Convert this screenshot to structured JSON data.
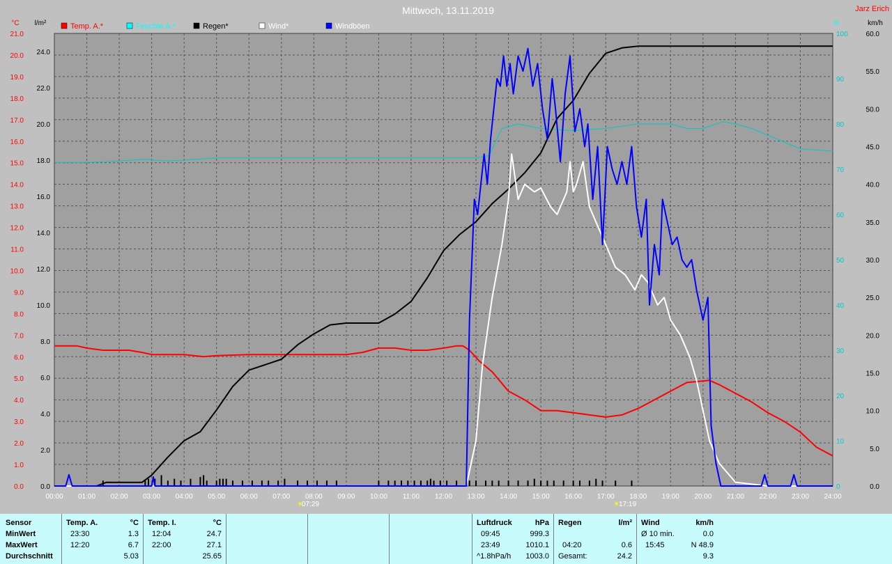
{
  "header": {
    "title": "Mittwoch, 13.11.2019",
    "author": "Jarz Erich"
  },
  "colors": {
    "temp": "#ff0000",
    "humidity": "#00c8c8",
    "rain": "#000000",
    "wind": "#ffffff",
    "gust": "#0000ff",
    "bg": "#c0c0c0",
    "plot": "#a0a0a0",
    "grid": "#606060",
    "stats_bg": "#c8fcfc"
  },
  "axes": {
    "left_temp_unit": "°C",
    "left_rain_unit": "l/m²",
    "right_hum_unit": "%",
    "right_wind_unit": "km/h",
    "sunrise": "07:29",
    "sunset": "17:19"
  },
  "chart_data": {
    "type": "line",
    "x_unit": "hours",
    "x_ticks": [
      "00:00",
      "01:00",
      "02:00",
      "03:00",
      "04:00",
      "05:00",
      "06:00",
      "07:00",
      "08:00",
      "09:00",
      "10:00",
      "11:00",
      "12:00",
      "13:00",
      "14:00",
      "15:00",
      "16:00",
      "17:00",
      "18:00",
      "19:00",
      "20:00",
      "21:00",
      "22:00",
      "23:00",
      "24:00"
    ],
    "xlim": [
      0,
      24
    ],
    "temp_ticks": [
      "0.0",
      "1.0",
      "2.0",
      "3.0",
      "4.0",
      "5.0",
      "6.0",
      "7.0",
      "8.0",
      "9.0",
      "10.0",
      "11.0",
      "12.0",
      "13.0",
      "14.0",
      "15.0",
      "16.0",
      "17.0",
      "18.0",
      "19.0",
      "20.0",
      "21.0"
    ],
    "temp_lim": [
      0,
      21
    ],
    "rain_ticks": [
      "0.0",
      "2.0",
      "4.0",
      "6.0",
      "8.0",
      "10.0",
      "12.0",
      "14.0",
      "16.0",
      "18.0",
      "20.0",
      "22.0",
      "24.0"
    ],
    "rain_lim": [
      0,
      25
    ],
    "hum_ticks": [
      "0",
      "10",
      "20",
      "30",
      "40",
      "50",
      "60",
      "70",
      "80",
      "90",
      "100"
    ],
    "hum_lim": [
      0,
      100
    ],
    "wind_ticks": [
      "0.0",
      "5.0",
      "10.0",
      "15.0",
      "20.0",
      "25.0",
      "30.0",
      "35.0",
      "40.0",
      "45.0",
      "50.0",
      "55.0",
      "60.0"
    ],
    "wind_lim": [
      0,
      60
    ],
    "series": [
      {
        "name": "Temp. A.*",
        "axis": "temp",
        "color": "#ff0000",
        "points": [
          [
            0,
            6.5
          ],
          [
            0.7,
            6.5
          ],
          [
            1,
            6.4
          ],
          [
            1.5,
            6.3
          ],
          [
            2,
            6.3
          ],
          [
            2.3,
            6.3
          ],
          [
            2.7,
            6.2
          ],
          [
            3,
            6.1
          ],
          [
            4,
            6.1
          ],
          [
            4.6,
            6.0
          ],
          [
            5,
            6.05
          ],
          [
            6,
            6.1
          ],
          [
            7,
            6.1
          ],
          [
            8,
            6.1
          ],
          [
            9,
            6.1
          ],
          [
            9.5,
            6.2
          ],
          [
            10,
            6.4
          ],
          [
            10.5,
            6.4
          ],
          [
            11,
            6.3
          ],
          [
            11.5,
            6.3
          ],
          [
            12,
            6.4
          ],
          [
            12.4,
            6.5
          ],
          [
            12.6,
            6.5
          ],
          [
            12.8,
            6.3
          ],
          [
            13.1,
            5.8
          ],
          [
            13.5,
            5.3
          ],
          [
            14,
            4.4
          ],
          [
            14.5,
            4.0
          ],
          [
            15,
            3.5
          ],
          [
            15.5,
            3.5
          ],
          [
            16,
            3.4
          ],
          [
            16.5,
            3.3
          ],
          [
            17,
            3.2
          ],
          [
            17.5,
            3.3
          ],
          [
            18,
            3.6
          ],
          [
            18.5,
            4.0
          ],
          [
            19,
            4.4
          ],
          [
            19.5,
            4.8
          ],
          [
            20.2,
            4.9
          ],
          [
            20.5,
            4.7
          ],
          [
            21,
            4.3
          ],
          [
            21.5,
            3.9
          ],
          [
            22,
            3.4
          ],
          [
            22.5,
            3.0
          ],
          [
            23,
            2.5
          ],
          [
            23.5,
            1.8
          ],
          [
            24,
            1.4
          ]
        ]
      },
      {
        "name": "Feuchte A.*",
        "axis": "hum",
        "color": "#00c8c8",
        "points": [
          [
            0,
            71.5
          ],
          [
            1,
            71.5
          ],
          [
            2,
            71.8
          ],
          [
            2.8,
            72.2
          ],
          [
            3.5,
            71.8
          ],
          [
            4,
            72
          ],
          [
            5,
            72.5
          ],
          [
            6,
            72.5
          ],
          [
            8,
            72.5
          ],
          [
            10,
            72.5
          ],
          [
            12,
            72.5
          ],
          [
            13,
            72.5
          ],
          [
            13.4,
            73
          ],
          [
            13.8,
            79
          ],
          [
            14.3,
            80
          ],
          [
            15,
            79
          ],
          [
            16,
            78.5
          ],
          [
            17,
            79
          ],
          [
            18,
            80
          ],
          [
            19,
            80
          ],
          [
            19.5,
            79
          ],
          [
            20,
            79
          ],
          [
            20.6,
            80.5
          ],
          [
            21,
            80
          ],
          [
            21.5,
            79
          ],
          [
            22,
            77.5
          ],
          [
            22.5,
            76
          ],
          [
            23,
            74.5
          ],
          [
            24,
            74
          ]
        ]
      },
      {
        "name": "Regen*",
        "axis": "rain",
        "color": "#000000",
        "points": [
          [
            0,
            0
          ],
          [
            1.3,
            0
          ],
          [
            1.6,
            0.2
          ],
          [
            2,
            0.2
          ],
          [
            2.7,
            0.2
          ],
          [
            3,
            0.6
          ],
          [
            3.5,
            1.6
          ],
          [
            4,
            2.5
          ],
          [
            4.5,
            3.0
          ],
          [
            5,
            4.2
          ],
          [
            5.5,
            5.5
          ],
          [
            6,
            6.4
          ],
          [
            6.5,
            6.7
          ],
          [
            7,
            7.0
          ],
          [
            7.5,
            7.8
          ],
          [
            8,
            8.4
          ],
          [
            8.5,
            8.9
          ],
          [
            9,
            9.0
          ],
          [
            10,
            9.0
          ],
          [
            10.5,
            9.5
          ],
          [
            11,
            10.2
          ],
          [
            11.5,
            11.5
          ],
          [
            12,
            13.0
          ],
          [
            12.5,
            13.9
          ],
          [
            13,
            14.6
          ],
          [
            13.5,
            15.6
          ],
          [
            14,
            16.4
          ],
          [
            14.5,
            17.3
          ],
          [
            15,
            18.4
          ],
          [
            15.5,
            20.3
          ],
          [
            16,
            21.3
          ],
          [
            16.5,
            22.8
          ],
          [
            17,
            23.9
          ],
          [
            17.5,
            24.2
          ],
          [
            18,
            24.3
          ],
          [
            20,
            24.3
          ],
          [
            22,
            24.3
          ],
          [
            24,
            24.3
          ]
        ]
      },
      {
        "name": "Wind*",
        "axis": "wind",
        "color": "#ffffff",
        "points": [
          [
            0,
            0
          ],
          [
            12.7,
            0
          ],
          [
            13,
            6
          ],
          [
            13.2,
            16
          ],
          [
            13.5,
            25
          ],
          [
            13.8,
            32
          ],
          [
            14,
            38
          ],
          [
            14.1,
            44
          ],
          [
            14.3,
            38
          ],
          [
            14.5,
            40
          ],
          [
            14.8,
            39
          ],
          [
            15,
            39.5
          ],
          [
            15.3,
            37
          ],
          [
            15.5,
            36
          ],
          [
            15.8,
            39
          ],
          [
            15.9,
            43
          ],
          [
            16,
            39
          ],
          [
            16.1,
            40
          ],
          [
            16.3,
            43
          ],
          [
            16.5,
            37
          ],
          [
            16.8,
            34
          ],
          [
            17,
            32
          ],
          [
            17.3,
            29
          ],
          [
            17.6,
            28
          ],
          [
            17.9,
            26
          ],
          [
            18.1,
            28
          ],
          [
            18.3,
            27
          ],
          [
            18.6,
            24
          ],
          [
            18.8,
            25
          ],
          [
            19,
            22
          ],
          [
            19.3,
            20
          ],
          [
            19.6,
            17
          ],
          [
            19.8,
            14
          ],
          [
            20,
            10
          ],
          [
            20.2,
            6
          ],
          [
            20.5,
            3
          ],
          [
            21,
            0.5
          ],
          [
            22,
            0
          ],
          [
            24,
            0
          ]
        ]
      },
      {
        "name": "Windböen",
        "axis": "wind",
        "color": "#0000ff",
        "points": [
          [
            0,
            0
          ],
          [
            0.35,
            0
          ],
          [
            0.45,
            1.5
          ],
          [
            0.55,
            0
          ],
          [
            3.0,
            0
          ],
          [
            3.05,
            1.2
          ],
          [
            3.1,
            0
          ],
          [
            12.7,
            0
          ],
          [
            12.8,
            22
          ],
          [
            12.95,
            38
          ],
          [
            13.05,
            36
          ],
          [
            13.15,
            40
          ],
          [
            13.25,
            44
          ],
          [
            13.35,
            40
          ],
          [
            13.45,
            46
          ],
          [
            13.55,
            50
          ],
          [
            13.65,
            54
          ],
          [
            13.75,
            53
          ],
          [
            13.85,
            57
          ],
          [
            13.95,
            53
          ],
          [
            14.05,
            56
          ],
          [
            14.15,
            52
          ],
          [
            14.3,
            57
          ],
          [
            14.45,
            55
          ],
          [
            14.6,
            58
          ],
          [
            14.75,
            53
          ],
          [
            14.9,
            56
          ],
          [
            15.05,
            50
          ],
          [
            15.2,
            46
          ],
          [
            15.35,
            54
          ],
          [
            15.45,
            50
          ],
          [
            15.6,
            43
          ],
          [
            15.75,
            52
          ],
          [
            15.9,
            57
          ],
          [
            16.05,
            47
          ],
          [
            16.2,
            50
          ],
          [
            16.35,
            45
          ],
          [
            16.45,
            48
          ],
          [
            16.6,
            38
          ],
          [
            16.75,
            45
          ],
          [
            16.9,
            32
          ],
          [
            17.05,
            45
          ],
          [
            17.2,
            42
          ],
          [
            17.35,
            40
          ],
          [
            17.5,
            43
          ],
          [
            17.65,
            40
          ],
          [
            17.8,
            45
          ],
          [
            17.95,
            37
          ],
          [
            18.1,
            33
          ],
          [
            18.25,
            38
          ],
          [
            18.35,
            24
          ],
          [
            18.5,
            32
          ],
          [
            18.65,
            28
          ],
          [
            18.75,
            38
          ],
          [
            18.9,
            35
          ],
          [
            19.05,
            32
          ],
          [
            19.2,
            33
          ],
          [
            19.35,
            30
          ],
          [
            19.5,
            29
          ],
          [
            19.65,
            30
          ],
          [
            19.8,
            26
          ],
          [
            20.0,
            22
          ],
          [
            20.15,
            25
          ],
          [
            20.25,
            8
          ],
          [
            20.4,
            3
          ],
          [
            20.55,
            0
          ],
          [
            21.8,
            0
          ],
          [
            21.9,
            1.5
          ],
          [
            22.0,
            0
          ],
          [
            22.7,
            0
          ],
          [
            22.8,
            1.5
          ],
          [
            22.9,
            0
          ],
          [
            24,
            0
          ]
        ]
      }
    ],
    "rain_bars": [
      [
        1.5,
        0.3
      ],
      [
        2.8,
        0.3
      ],
      [
        2.9,
        0.4
      ],
      [
        3.1,
        0.4
      ],
      [
        3.3,
        0.6
      ],
      [
        3.5,
        0.3
      ],
      [
        3.7,
        0.4
      ],
      [
        3.9,
        0.3
      ],
      [
        4.2,
        0.4
      ],
      [
        4.5,
        0.5
      ],
      [
        4.6,
        0.6
      ],
      [
        4.7,
        0.3
      ],
      [
        5.0,
        0.3
      ],
      [
        5.1,
        0.4
      ],
      [
        5.2,
        0.4
      ],
      [
        5.3,
        0.4
      ],
      [
        5.5,
        0.3
      ],
      [
        5.8,
        0.3
      ],
      [
        6.1,
        0.3
      ],
      [
        6.4,
        0.3
      ],
      [
        6.6,
        0.3
      ],
      [
        6.9,
        0.3
      ],
      [
        7.1,
        0.4
      ],
      [
        7.5,
        0.3
      ],
      [
        7.8,
        0.3
      ],
      [
        8.1,
        0.3
      ],
      [
        8.4,
        0.3
      ],
      [
        8.7,
        0.3
      ],
      [
        10.0,
        0.3
      ],
      [
        10.3,
        0.3
      ],
      [
        10.5,
        0.3
      ],
      [
        10.7,
        0.3
      ],
      [
        10.9,
        0.3
      ],
      [
        11.1,
        0.3
      ],
      [
        11.3,
        0.3
      ],
      [
        11.5,
        0.3
      ],
      [
        11.6,
        0.4
      ],
      [
        11.7,
        0.3
      ],
      [
        11.9,
        0.3
      ],
      [
        12.1,
        0.3
      ],
      [
        12.4,
        0.3
      ],
      [
        12.8,
        0.3
      ],
      [
        13.0,
        0.3
      ],
      [
        13.3,
        0.3
      ],
      [
        13.5,
        0.3
      ],
      [
        13.7,
        0.3
      ],
      [
        14.0,
        0.3
      ],
      [
        14.3,
        0.3
      ],
      [
        14.6,
        0.3
      ],
      [
        14.8,
        0.4
      ],
      [
        15.0,
        0.3
      ],
      [
        15.2,
        0.3
      ],
      [
        15.4,
        0.3
      ],
      [
        15.7,
        0.3
      ],
      [
        16.0,
        0.3
      ],
      [
        16.2,
        0.3
      ],
      [
        16.5,
        0.3
      ],
      [
        16.7,
        0.4
      ],
      [
        16.9,
        0.3
      ],
      [
        17.3,
        0.3
      ],
      [
        17.8,
        0.3
      ]
    ]
  },
  "legend": [
    {
      "label": "Temp. A.*",
      "color": "#ff0000",
      "text_color": "#ff0000"
    },
    {
      "label": "Feuchte A.*",
      "color": "#00ffff",
      "text_color": "#00ffff"
    },
    {
      "label": "Regen*",
      "color": "#000000",
      "text_color": "#000000"
    },
    {
      "label": "Wind*",
      "color": "#ffffff",
      "text_color": "#ffffff"
    },
    {
      "label": "Windböen",
      "color": "#0000ff",
      "text_color": "#ffffff"
    }
  ],
  "stats": {
    "row_labels": [
      "Sensor",
      "MinWert",
      "MaxWert",
      "Durchschnitt"
    ],
    "temp_a": {
      "title": "Temp. A.",
      "unit": "°C",
      "min_time": "23:30",
      "min": "1.3",
      "max_time": "12:20",
      "max": "6.7",
      "avg": "5.03"
    },
    "temp_i": {
      "title": "Temp. I.",
      "unit": "°C",
      "min_time": "12:04",
      "min": "24.7",
      "max_time": "22:00",
      "max": "27.1",
      "avg": "25.65"
    },
    "pressure": {
      "title": "Luftdruck",
      "unit": "hPa",
      "min_time": "09:45",
      "min": "999.3",
      "max_time": "23:49",
      "max": "1010.1",
      "trend_label": "^1.8hPa/h",
      "avg": "1003.0"
    },
    "rain": {
      "title": "Regen",
      "unit": "l/m²",
      "max_time": "04:20",
      "max": "0.6",
      "total_label": "Gesamt:",
      "total": "24.2"
    },
    "wind": {
      "title": "Wind",
      "unit": "km/h",
      "min_label": "Ø 10 min.",
      "min": "0.0",
      "max_time": "15:45",
      "max": "N 48.9",
      "avg": "9.3"
    }
  }
}
